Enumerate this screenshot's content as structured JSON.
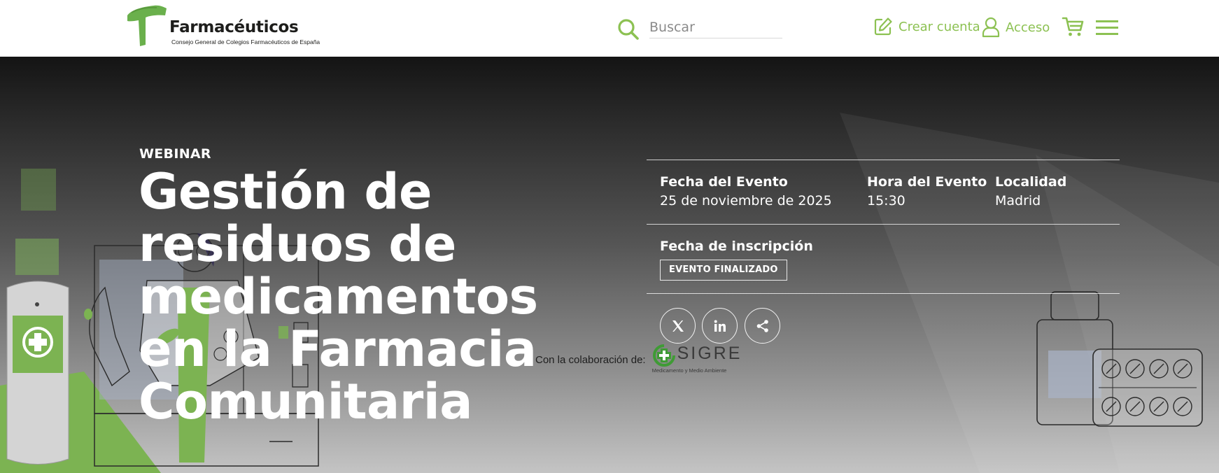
{
  "header": {
    "logo": {
      "title": "Farmacéuticos",
      "subtitle": "Consejo General de Colegios Farmacéuticos de España"
    },
    "search": {
      "placeholder": "Buscar",
      "icon": "search-icon"
    },
    "crear_cuenta": {
      "label": "Crear cuenta",
      "icon": "edit-icon"
    },
    "acceso": {
      "label": "Acceso",
      "icon": "user-icon"
    },
    "cart_icon": "cart-icon",
    "menu_icon": "hamburger-menu-icon"
  },
  "event": {
    "eyebrow": "WEBINAR",
    "title": "Gestión de residuos de medicamentos en la Farmacia Comunitaria",
    "fecha_label": "Fecha del Evento",
    "fecha_value": "25 de noviembre de 2025",
    "hora_label": "Hora del Evento",
    "hora_value": "15:30",
    "localidad_label": "Localidad",
    "localidad_value": "Madrid",
    "inscripcion_label": "Fecha de inscripción",
    "status_badge": "EVENTO FINALIZADO",
    "share_icons": [
      "x-twitter-icon",
      "linkedin-icon",
      "share-icon"
    ]
  },
  "collaboration": {
    "label": "Con la colaboración de:",
    "partner_name": "SIGRE",
    "partner_tagline": "Medicamento y Medio Ambiente"
  },
  "colors": {
    "brand_green": "#8cc152",
    "dark_green": "#3f9b35",
    "text_white": "#ffffff"
  }
}
